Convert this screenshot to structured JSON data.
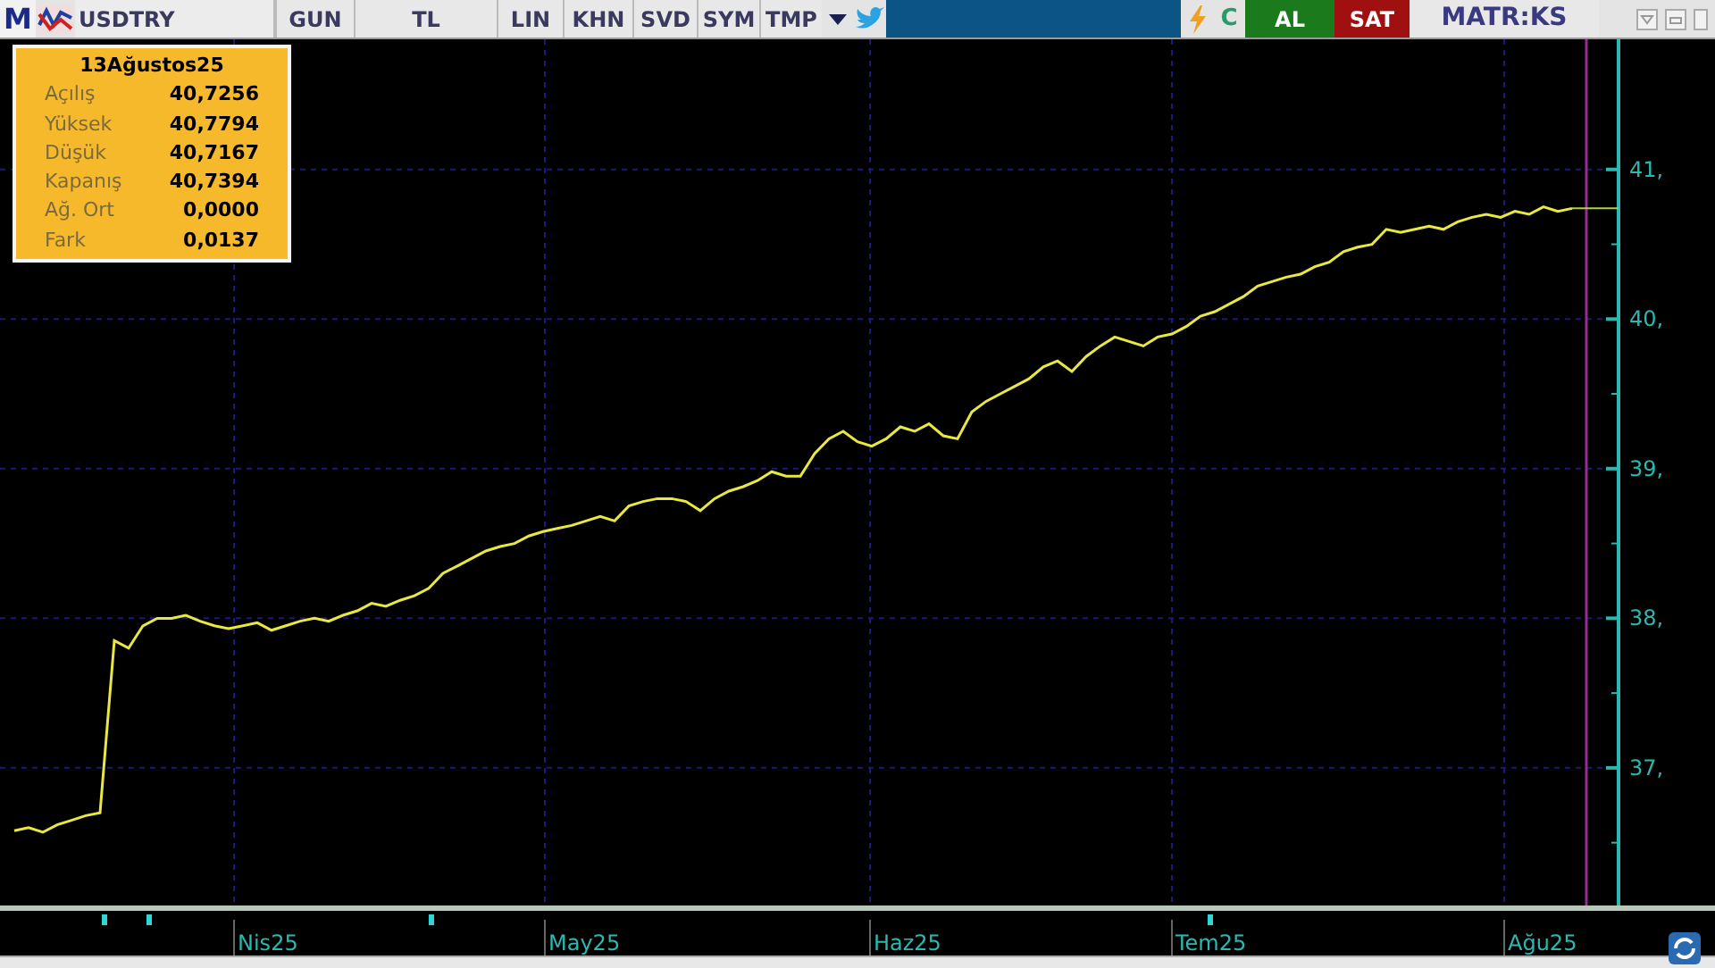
{
  "toolbar": {
    "logo": "M",
    "symbol": "USDTRY",
    "buttons": [
      "GUN",
      "TL",
      "LIN",
      "KHN",
      "SVD",
      "SYM",
      "TMP"
    ],
    "refresh": "C",
    "buy": "AL",
    "sell": "SAT",
    "brand": "MATR:KS"
  },
  "info_box": {
    "date": "13Ağustos25",
    "rows": [
      {
        "label": "Açılış",
        "value": "40,7256"
      },
      {
        "label": "Yüksek",
        "value": "40,7794"
      },
      {
        "label": "Düşük",
        "value": "40,7167"
      },
      {
        "label": "Kapanış",
        "value": "40,7394"
      },
      {
        "label": "Ağ. Ort",
        "value": "0,0000"
      },
      {
        "label": "Fark",
        "value": "0,0137"
      }
    ]
  },
  "chart": {
    "chart_data": {
      "type": "line",
      "yticks": [
        {
          "value": 37,
          "label": "37,"
        },
        {
          "value": 38,
          "label": "38,"
        },
        {
          "value": 39,
          "label": "39,"
        },
        {
          "value": 40,
          "label": "40,"
        },
        {
          "value": 41,
          "label": "41,"
        }
      ],
      "ylim": [
        36.08,
        41.87
      ],
      "grid": true,
      "series": [
        {
          "color": "#e8e840",
          "values": [
            36.58,
            36.6,
            36.57,
            36.62,
            36.65,
            36.68,
            36.7,
            37.85,
            37.8,
            37.95,
            38.0,
            38.0,
            38.02,
            37.98,
            37.95,
            37.93,
            37.95,
            37.97,
            37.92,
            37.95,
            37.98,
            38.0,
            37.98,
            38.02,
            38.05,
            38.1,
            38.08,
            38.12,
            38.15,
            38.2,
            38.3,
            38.35,
            38.4,
            38.45,
            38.48,
            38.5,
            38.55,
            38.58,
            38.6,
            38.62,
            38.65,
            38.68,
            38.65,
            38.75,
            38.78,
            38.8,
            38.8,
            38.78,
            38.72,
            38.8,
            38.85,
            38.88,
            38.92,
            38.98,
            38.95,
            38.95,
            39.1,
            39.2,
            39.25,
            39.18,
            39.15,
            39.2,
            39.28,
            39.25,
            39.3,
            39.22,
            39.2,
            39.38,
            39.45,
            39.5,
            39.55,
            39.6,
            39.68,
            39.72,
            39.65,
            39.75,
            39.82,
            39.88,
            39.85,
            39.82,
            39.88,
            39.9,
            39.95,
            40.02,
            40.05,
            40.1,
            40.15,
            40.22,
            40.25,
            40.28,
            40.3,
            40.35,
            40.38,
            40.45,
            40.48,
            40.5,
            40.6,
            40.58,
            40.6,
            40.62,
            40.6,
            40.65,
            40.68,
            40.7,
            40.68,
            40.72,
            40.7,
            40.75,
            40.72,
            40.74
          ]
        }
      ]
    },
    "x_axis_labels": [
      "Nis25",
      "May25",
      "Haz25",
      "Tem25",
      "Ağu25"
    ]
  }
}
